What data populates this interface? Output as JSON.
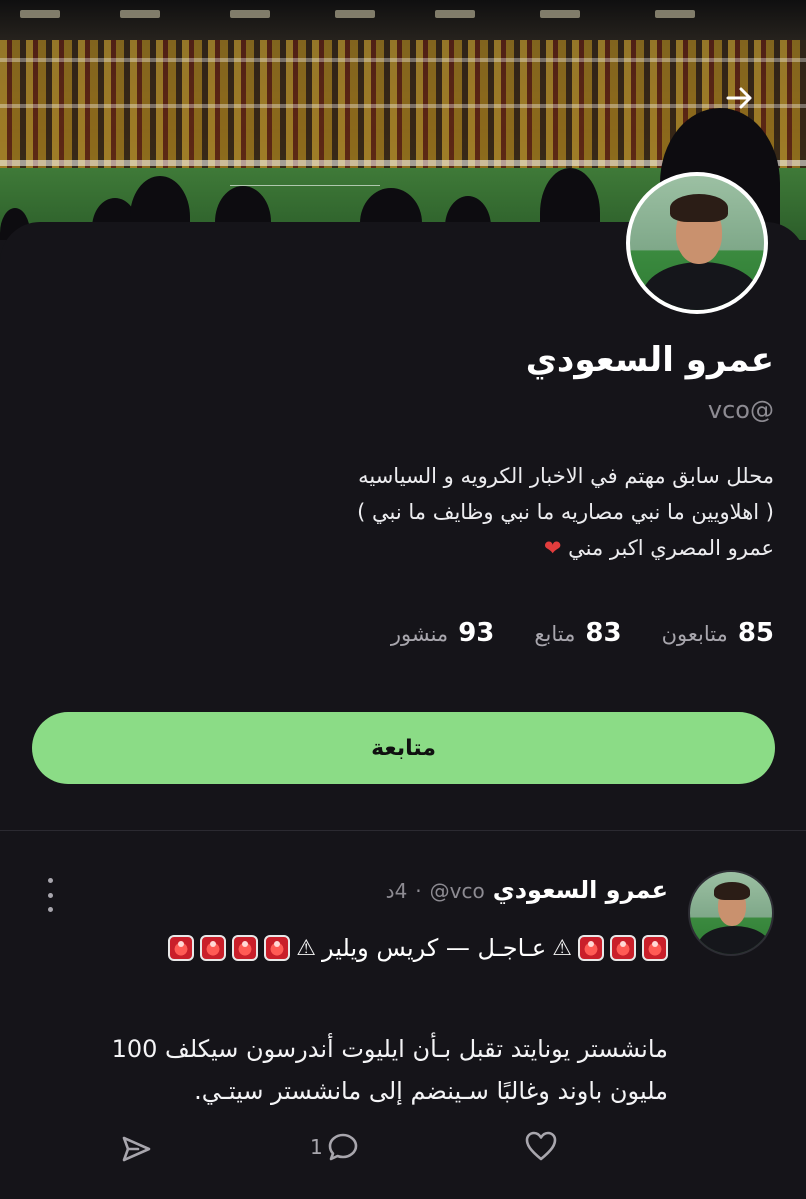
{
  "profile": {
    "name": "عمرو السعودي",
    "handle": "vco@",
    "bio": [
      "محلل سابق مهتم في الاخبار الكرويه و السياسيه",
      "( اهلاويين ما نبي مصاريه ما نبي وظايف ما نبي )",
      "عمرو المصري اكبر مني"
    ],
    "bio_emoji": "heart-emoji",
    "stats": {
      "followers_count": "85",
      "followers_label": "متابعون",
      "following_count": "83",
      "following_label": "متابع",
      "posts_count": "93",
      "posts_label": "منشور"
    },
    "follow_button_label": "متابعة"
  },
  "icons": {
    "header_action": "arrow-right-icon",
    "post_menu": "more-vertical-icon",
    "share": "send-icon",
    "reply": "comment-icon",
    "like": "heart-icon"
  },
  "post": {
    "author": "عمرو السعودي",
    "handle": "@vco",
    "separator": "·",
    "time": "4د",
    "headline_text": "عـاجـل — كريس ويلير",
    "body": "مانشستر يونايتد تقبل بـأن ايليوت أندرسون سيكلف 100 مليون باوند وغالبًا سـينضم إلى مانشستر سيتـي.",
    "reply_count": "1"
  },
  "colors": {
    "background": "#151419",
    "accent_button": "#8bdc86",
    "secondary_text": "#8d8b92",
    "heart_emoji": "#e23d3d"
  }
}
